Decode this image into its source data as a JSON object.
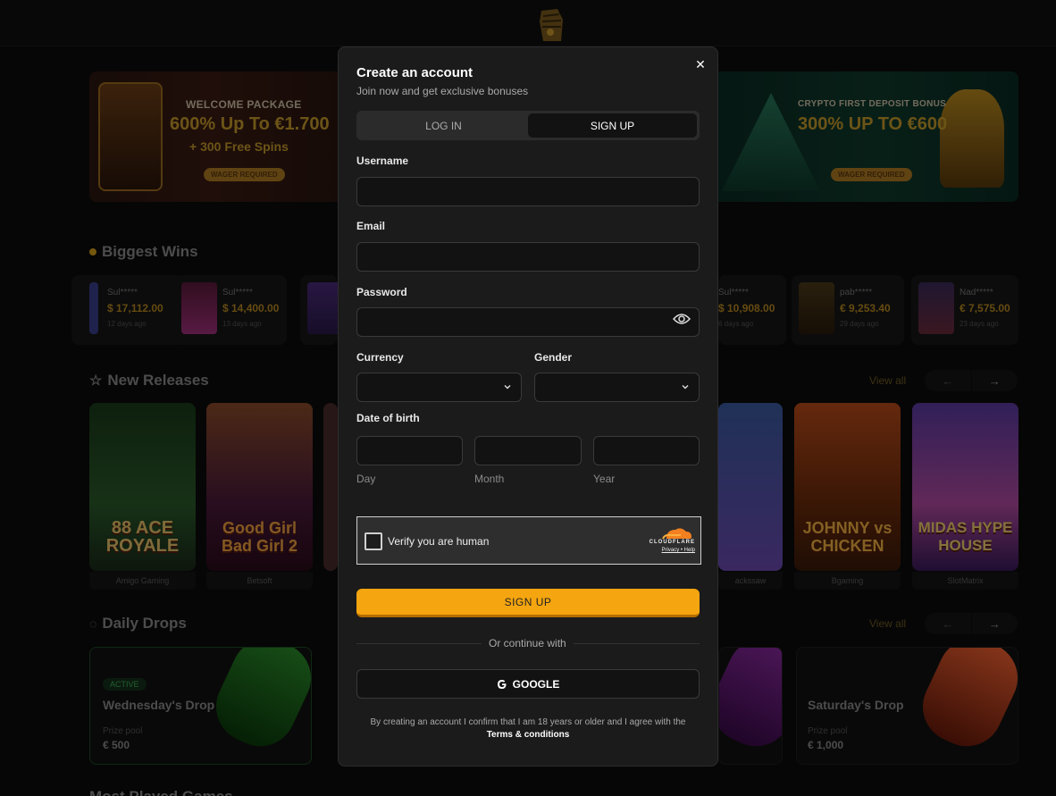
{
  "background": {
    "banners": {
      "left": {
        "title": "WELCOME PACKAGE",
        "big": "600% Up To €1.700",
        "sub": "+ 300 Free Spins",
        "pill": "WAGER REQUIRED"
      },
      "right": {
        "title": "CRYPTO FIRST DEPOSIT BONUS",
        "big": "300% UP TO €600",
        "pill": "WAGER REQUIRED"
      }
    },
    "biggest_wins": {
      "title": "Biggest Wins",
      "items": [
        {
          "user": "Sul*****",
          "amount": "$ 17,112.00",
          "time": "12 days ago"
        },
        {
          "user": "Sul*****",
          "amount": "$ 14,400.00",
          "time": "13 days ago"
        },
        {
          "user": "Sul*****",
          "amount": "$ 10,908.00",
          "time": "6 days ago"
        },
        {
          "user": "pab*****",
          "amount": "€ 9,253.40",
          "time": "29 days ago"
        },
        {
          "user": "Nad*****",
          "amount": "€ 7,575.00",
          "time": "23 days ago"
        }
      ]
    },
    "new_releases": {
      "title": "New Releases",
      "view_all": "View all",
      "games": [
        {
          "title": "88 ACE ROYALE",
          "provider": "Amigo Gaming"
        },
        {
          "title": "Good Girl Bad Girl 2",
          "provider": "Betsoft"
        },
        {
          "title": "",
          "provider": "ackssaw"
        },
        {
          "title": "JOHNNY vs CHICKEN",
          "provider": "Bgaming"
        },
        {
          "title": "MIDAS HYPE HOUSE",
          "provider": "SlotMatrix"
        }
      ]
    },
    "daily_drops": {
      "title": "Daily Drops",
      "view_all": "View all",
      "drops": [
        {
          "badge": "ACTIVE",
          "title": "Wednesday's Drop",
          "pool_label": "Prize pool",
          "amount": "€ 500"
        },
        {
          "title": "Saturday's Drop",
          "pool_label": "Prize pool",
          "amount": "€ 1,000"
        }
      ]
    },
    "bottom_title": "Most Played Games"
  },
  "modal": {
    "title": "Create an account",
    "subtitle": "Join now and get exclusive bonuses",
    "tabs": [
      {
        "label": "LOG IN",
        "selected": false
      },
      {
        "label": "SIGN UP",
        "selected": true
      }
    ],
    "fields": {
      "username": {
        "label": "Username",
        "value": "",
        "placeholder": ""
      },
      "email": {
        "label": "Email",
        "value": "",
        "placeholder": ""
      },
      "password": {
        "label": "Password",
        "value": "",
        "placeholder": ""
      },
      "currency": {
        "label": "Currency",
        "value": ""
      },
      "gender": {
        "label": "Gender",
        "value": ""
      },
      "dob": {
        "label": "Date of birth",
        "day_label": "Day",
        "month_label": "Month",
        "year_label": "Year"
      }
    },
    "captcha": {
      "text": "Verify you are human",
      "brand": "CLOUDFLARE",
      "links": "Privacy • Help"
    },
    "signup_button": "SIGN UP",
    "or_text": "Or continue with",
    "google_button": "GOOGLE",
    "terms_text": "By creating an account I confirm that I am 18 years or older and I agree with the",
    "terms_link": "Terms & conditions",
    "close_icon": "close-icon"
  },
  "colors": {
    "accent": "#f5a50f",
    "modal_bg": "#1b1b1b",
    "input_bg": "#121212"
  }
}
